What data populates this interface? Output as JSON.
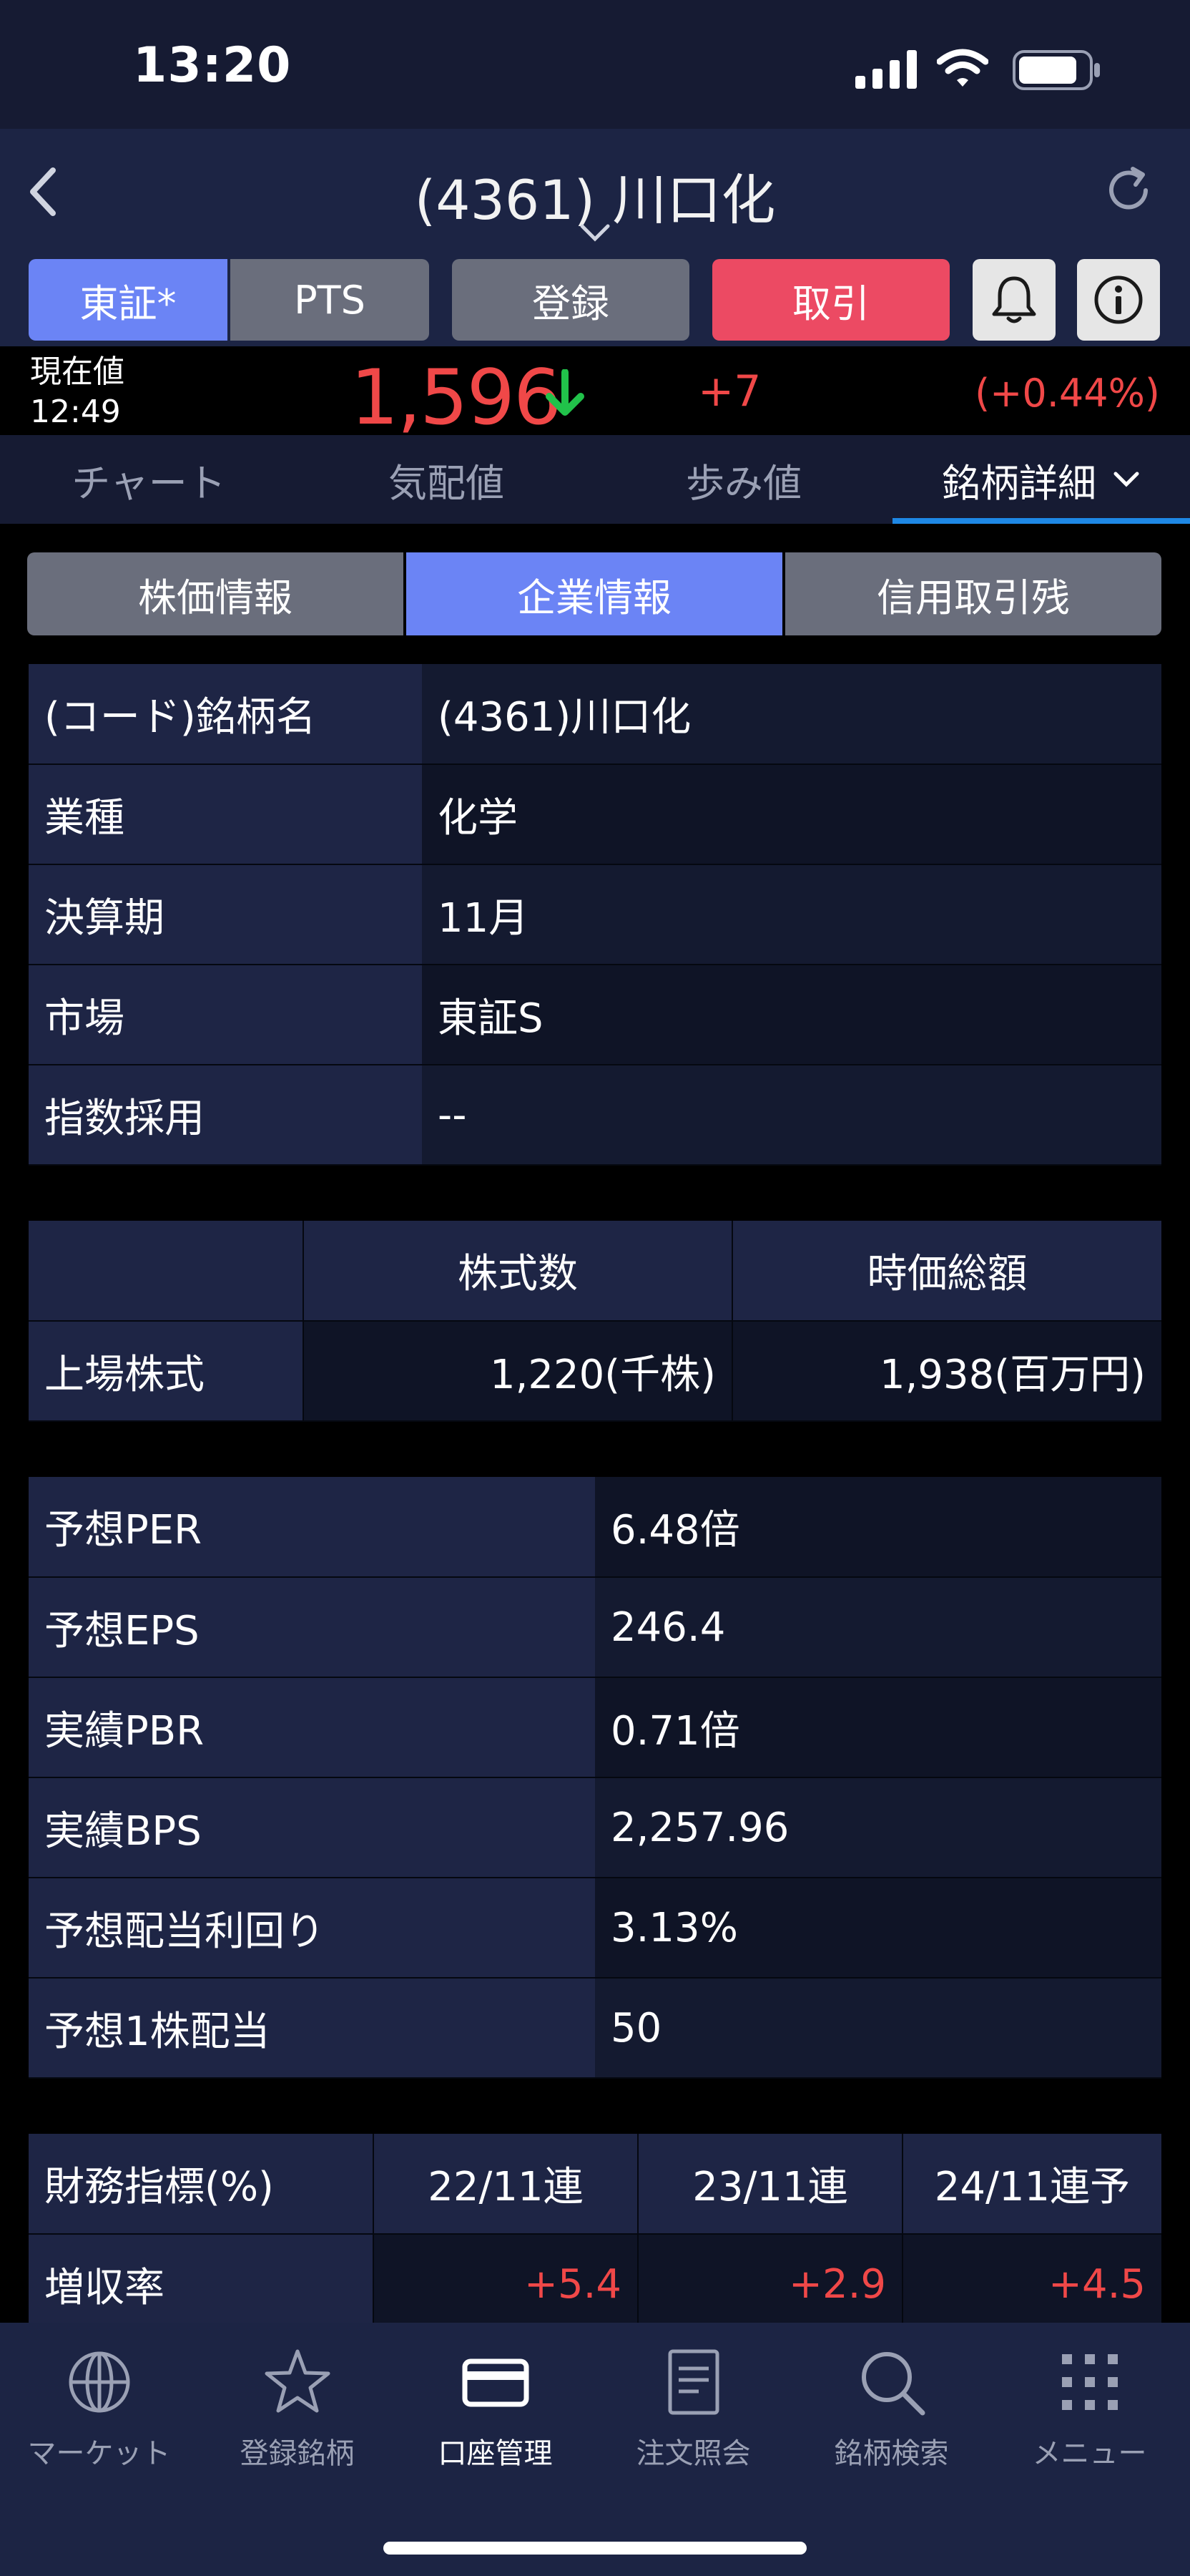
{
  "status_bar": {
    "time": "13:20"
  },
  "header": {
    "title": "(4361) 川口化"
  },
  "toolbar": {
    "tosho": "東証*",
    "pts": "PTS",
    "register": "登録",
    "trade": "取引"
  },
  "price": {
    "label_line1": "現在値",
    "time": "12:49",
    "value": "1,596",
    "change": "+7",
    "change_pct": "(+0.44%)",
    "up_color": "#f04848",
    "arrow_color": "#21c24a"
  },
  "tabs": [
    "チャート",
    "気配値",
    "歩み値",
    "銘柄詳細"
  ],
  "sub_tabs": [
    "株価情報",
    "企業情報",
    "信用取引残"
  ],
  "company_info": [
    {
      "label": "(コード)銘柄名",
      "value": "(4361)川口化"
    },
    {
      "label": "業種",
      "value": "化学"
    },
    {
      "label": "決算期",
      "value": "11月"
    },
    {
      "label": "市場",
      "value": "東証S"
    },
    {
      "label": "指数採用",
      "value": "--"
    }
  ],
  "shares": {
    "col_headers": [
      "株式数",
      "時価総額"
    ],
    "row_label": "上場株式",
    "share_count": "1,220(千株)",
    "market_cap": "1,938(百万円)"
  },
  "valuation": [
    {
      "label": "予想PER",
      "value": "6.48倍"
    },
    {
      "label": "予想EPS",
      "value": "246.4"
    },
    {
      "label": "実績PBR",
      "value": "0.71倍"
    },
    {
      "label": "実績BPS",
      "value": "2,257.96"
    },
    {
      "label": "予想配当利回り",
      "value": "3.13%"
    },
    {
      "label": "予想1株配当",
      "value": "50"
    }
  ],
  "financials": {
    "header_label": "財務指標(%)",
    "periods": [
      "22/11連",
      "23/11連",
      "24/11連予"
    ],
    "rows": [
      {
        "label": "増収率",
        "values": [
          "+5.4",
          "+2.9",
          "+4.5"
        ]
      }
    ]
  },
  "bottom_nav": [
    {
      "label": "マーケット",
      "icon": "globe-icon"
    },
    {
      "label": "登録銘柄",
      "icon": "star-icon"
    },
    {
      "label": "口座管理",
      "icon": "card-icon"
    },
    {
      "label": "注文照会",
      "icon": "document-icon"
    },
    {
      "label": "銘柄検索",
      "icon": "search-icon"
    },
    {
      "label": "メニュー",
      "icon": "grid-icon"
    }
  ]
}
